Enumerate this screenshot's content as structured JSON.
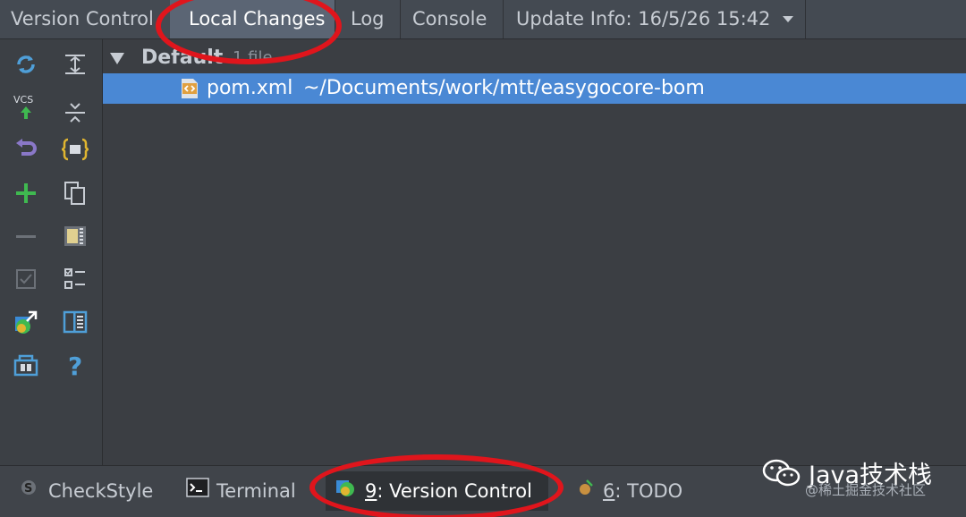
{
  "top_tabs": {
    "version_control": "Version Control",
    "local_changes": "Local Changes",
    "log": "Log",
    "console": "Console",
    "update_info": "Update Info: 16/5/26 15:42"
  },
  "left_toolbar": {
    "icons": [
      "refresh-icon",
      "vcs-commit-icon",
      "rollback-icon",
      "add-icon",
      "remove-icon",
      "checkbox-icon",
      "move-to-changelist-icon",
      "changelist-icon",
      "expand-all-icon",
      "collapse-all-icon",
      "group-by-icon",
      "copy-icon",
      "diff-icon",
      "select-icon",
      "preview-icon",
      "help-icon"
    ]
  },
  "changes": {
    "group_label": "Default",
    "group_count": "1 file",
    "file": {
      "name": "pom.xml",
      "path": "~/Documents/work/mtt/easygocore-bom",
      "icon": "xml-file-icon"
    }
  },
  "bottom_tabs": {
    "checkstyle": "CheckStyle",
    "terminal": "Terminal",
    "vcs_number": "9",
    "vcs_label": ": Version Control",
    "todo_number": "6",
    "todo_label": ": TODO"
  },
  "watermark": {
    "brand": "Java技术栈",
    "site": "@稀土掘金技术社区"
  },
  "colors": {
    "selection": "#4a88d4",
    "annotation": "#e0151c",
    "background": "#3b3e43"
  }
}
